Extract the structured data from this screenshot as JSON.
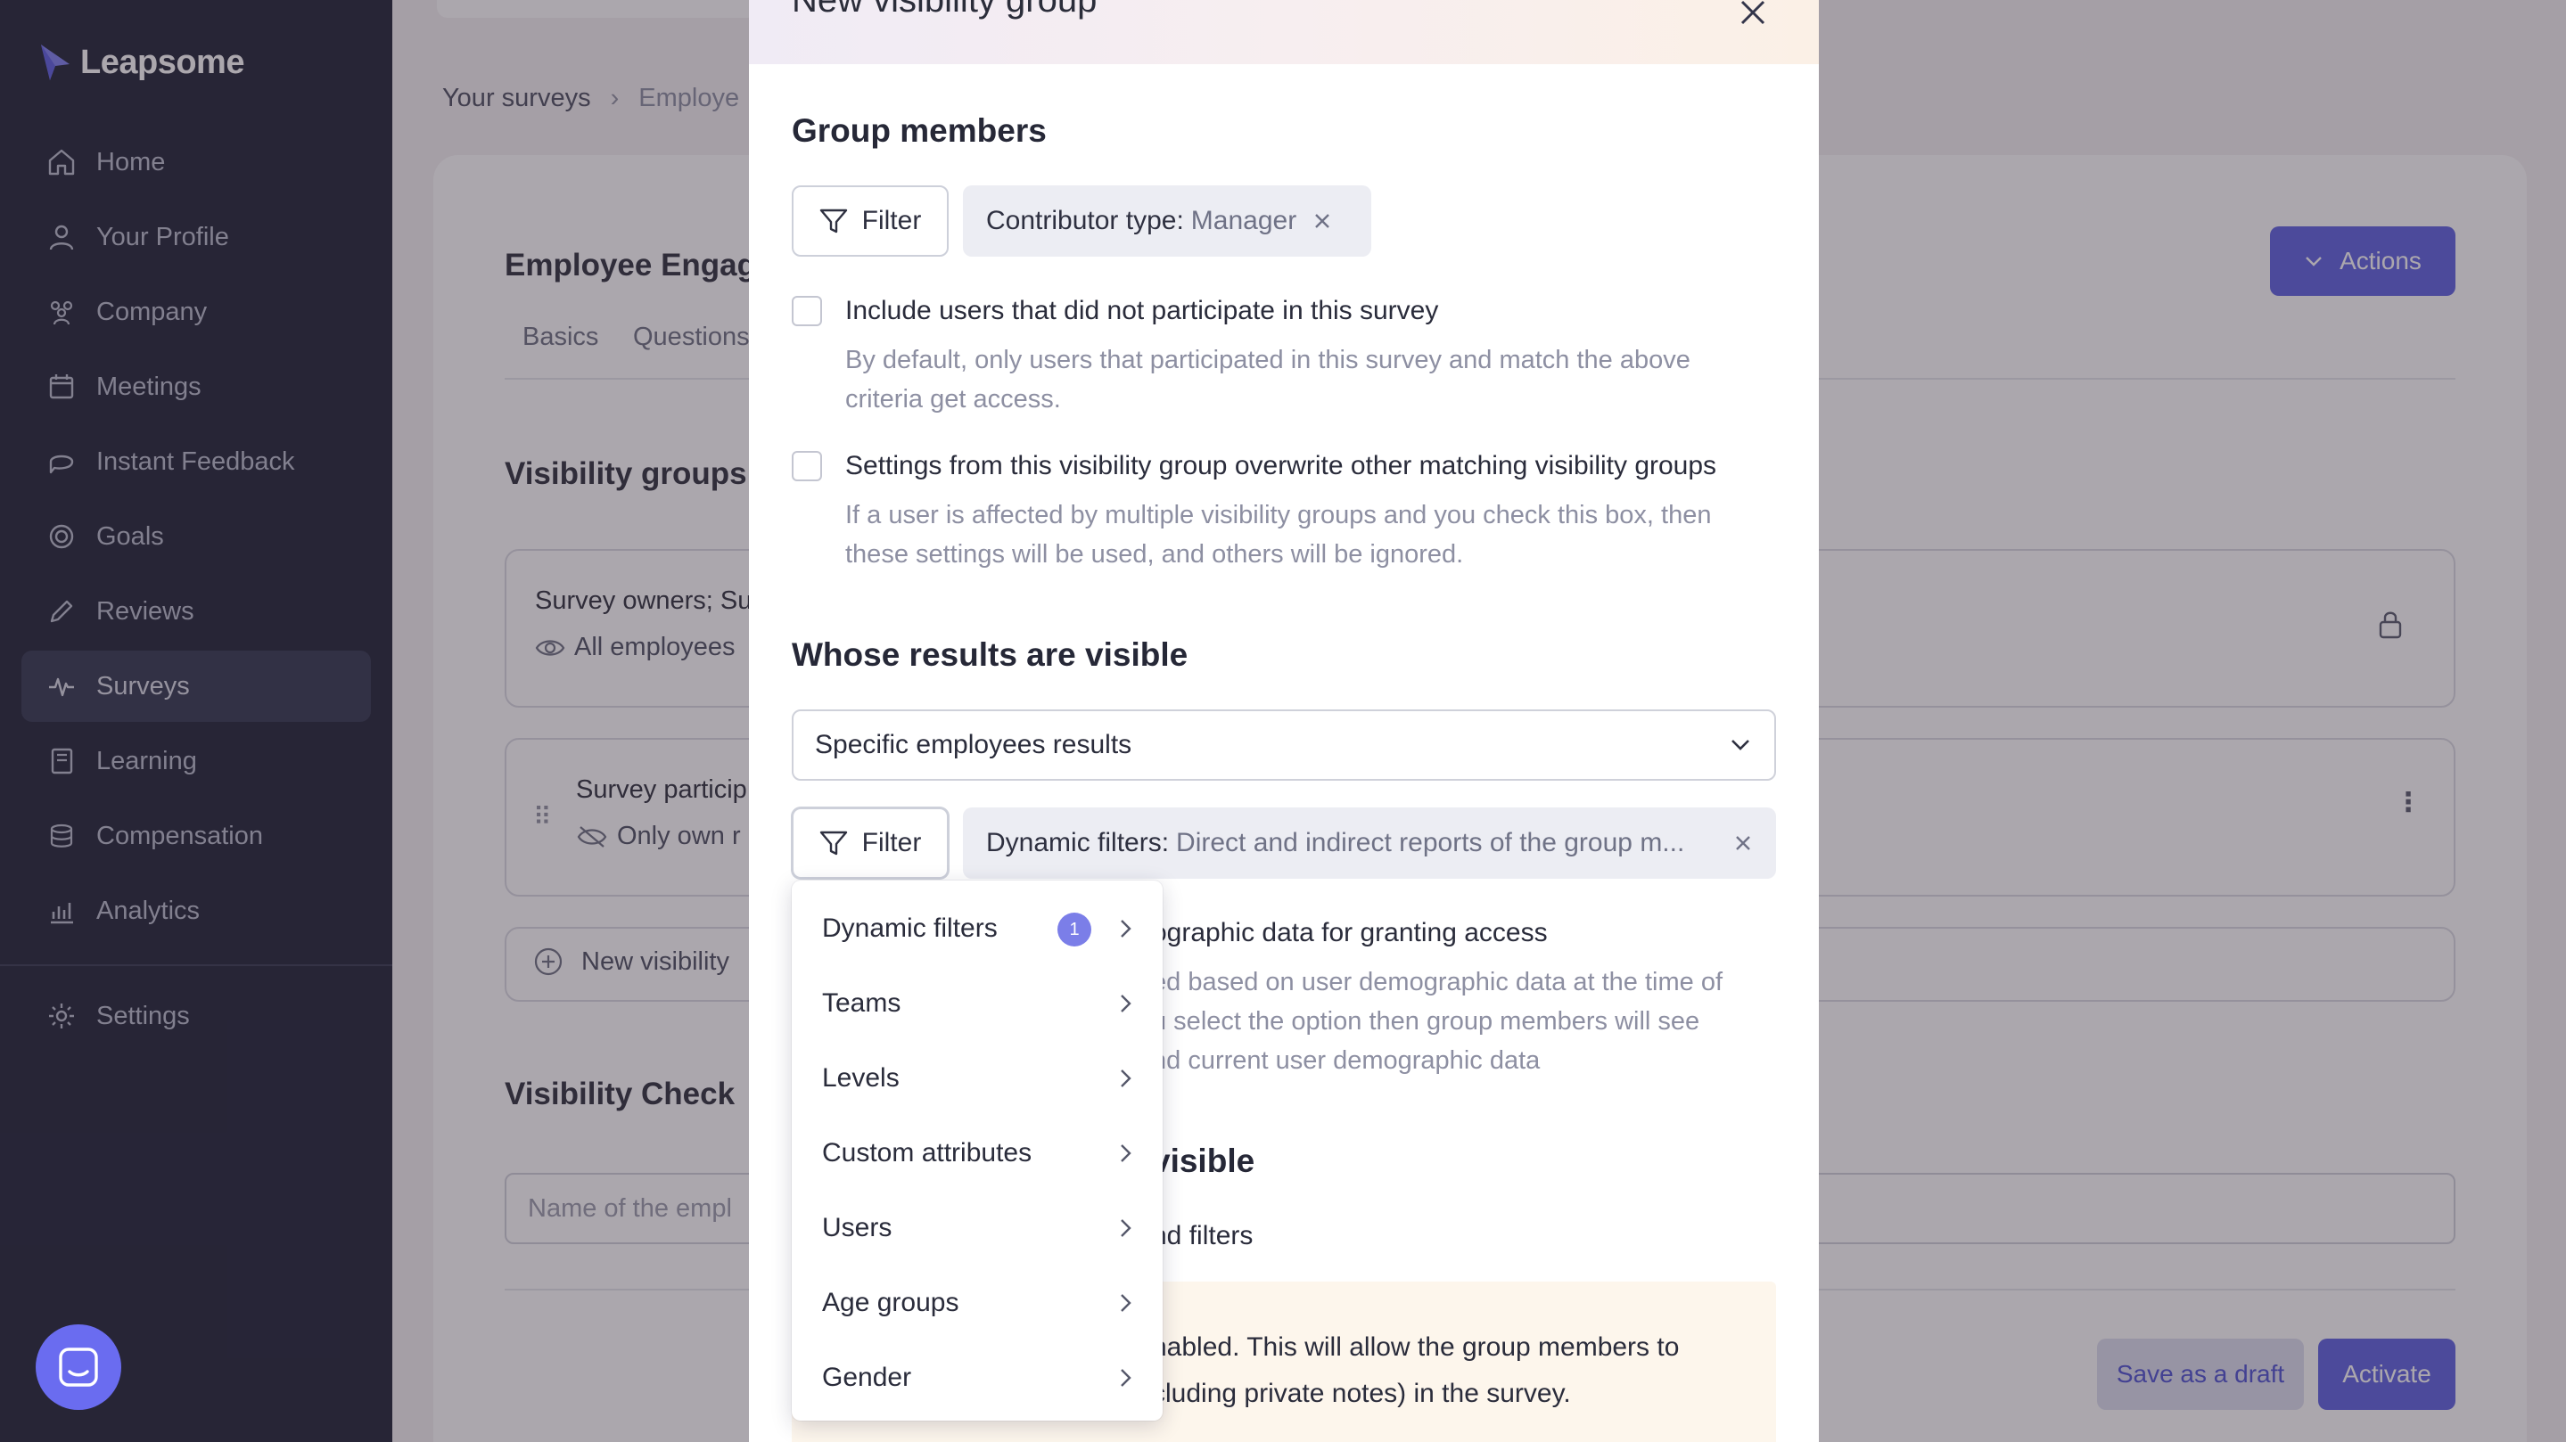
{
  "app": {
    "name": "Leapsome"
  },
  "sidebar": {
    "items": [
      {
        "label": "Home",
        "icon": "home-icon"
      },
      {
        "label": "Your Profile",
        "icon": "user-icon"
      },
      {
        "label": "Company",
        "icon": "people-icon"
      },
      {
        "label": "Meetings",
        "icon": "calendar-icon"
      },
      {
        "label": "Instant Feedback",
        "icon": "chat-icon"
      },
      {
        "label": "Goals",
        "icon": "target-icon"
      },
      {
        "label": "Reviews",
        "icon": "pen-icon"
      },
      {
        "label": "Surveys",
        "icon": "pulse-icon",
        "active": true
      },
      {
        "label": "Learning",
        "icon": "book-icon"
      },
      {
        "label": "Compensation",
        "icon": "coins-icon"
      },
      {
        "label": "Analytics",
        "icon": "chart-icon"
      }
    ],
    "settings_label": "Settings"
  },
  "background": {
    "breadcrumb": [
      "Your surveys",
      "Employe"
    ],
    "survey_title": "Employee Engag",
    "tabs": [
      "Basics",
      "Questions"
    ],
    "actions_label": "Actions",
    "visibility_groups_title": "Visibility groups",
    "group1": {
      "title": "Survey owners; Su",
      "subtitle": "All employees"
    },
    "group2": {
      "title": "Survey particip",
      "subtitle": "Only own r"
    },
    "new_group_label": "New visibility",
    "visibility_check_title": "Visibility Check",
    "employee_placeholder": "Name of the empl",
    "save_draft_label": "Save as a draft",
    "activate_label": "Activate"
  },
  "modal": {
    "title": "New visibility group",
    "group_members_title": "Group members",
    "filter_label": "Filter",
    "members_chip": {
      "key": "Contributor type:",
      "value": "Manager"
    },
    "checkbox1": {
      "label": "Include users that did not participate in this survey",
      "help": [
        "By default, only users that participated in this survey and match the above",
        "criteria get access."
      ]
    },
    "checkbox2": {
      "label": "Settings from this visibility group overwrite other matching visibility groups",
      "help": [
        "If a user is affected by multiple visibility groups and you check this box, then",
        "these settings will be used, and others will be ignored."
      ]
    },
    "results_title": "Whose results are visible",
    "results_select": "Specific employees results",
    "results_chip": {
      "key": "Dynamic filters:",
      "value": "Direct and indirect reports of the group m..."
    },
    "demographic_label": "ographic data for granting access",
    "demographic_help": [
      "ed based on user demographic data at the time of",
      "u select the option then group members will see",
      "nd current user demographic data"
    ],
    "visible_title_partial": "visible",
    "filters_partial": "nd filters",
    "notice_lines": [
      "nabled. This will allow the group members to",
      "cluding private notes) in the survey."
    ]
  },
  "dropdown": {
    "items": [
      {
        "label": "Dynamic filters",
        "badge": "1"
      },
      {
        "label": "Teams"
      },
      {
        "label": "Levels"
      },
      {
        "label": "Custom attributes"
      },
      {
        "label": "Users"
      },
      {
        "label": "Age groups"
      },
      {
        "label": "Gender"
      }
    ]
  },
  "colors": {
    "sidebar_bg": "#1c1f33",
    "accent": "#5c5fe0",
    "badge": "#7b7ee8"
  }
}
